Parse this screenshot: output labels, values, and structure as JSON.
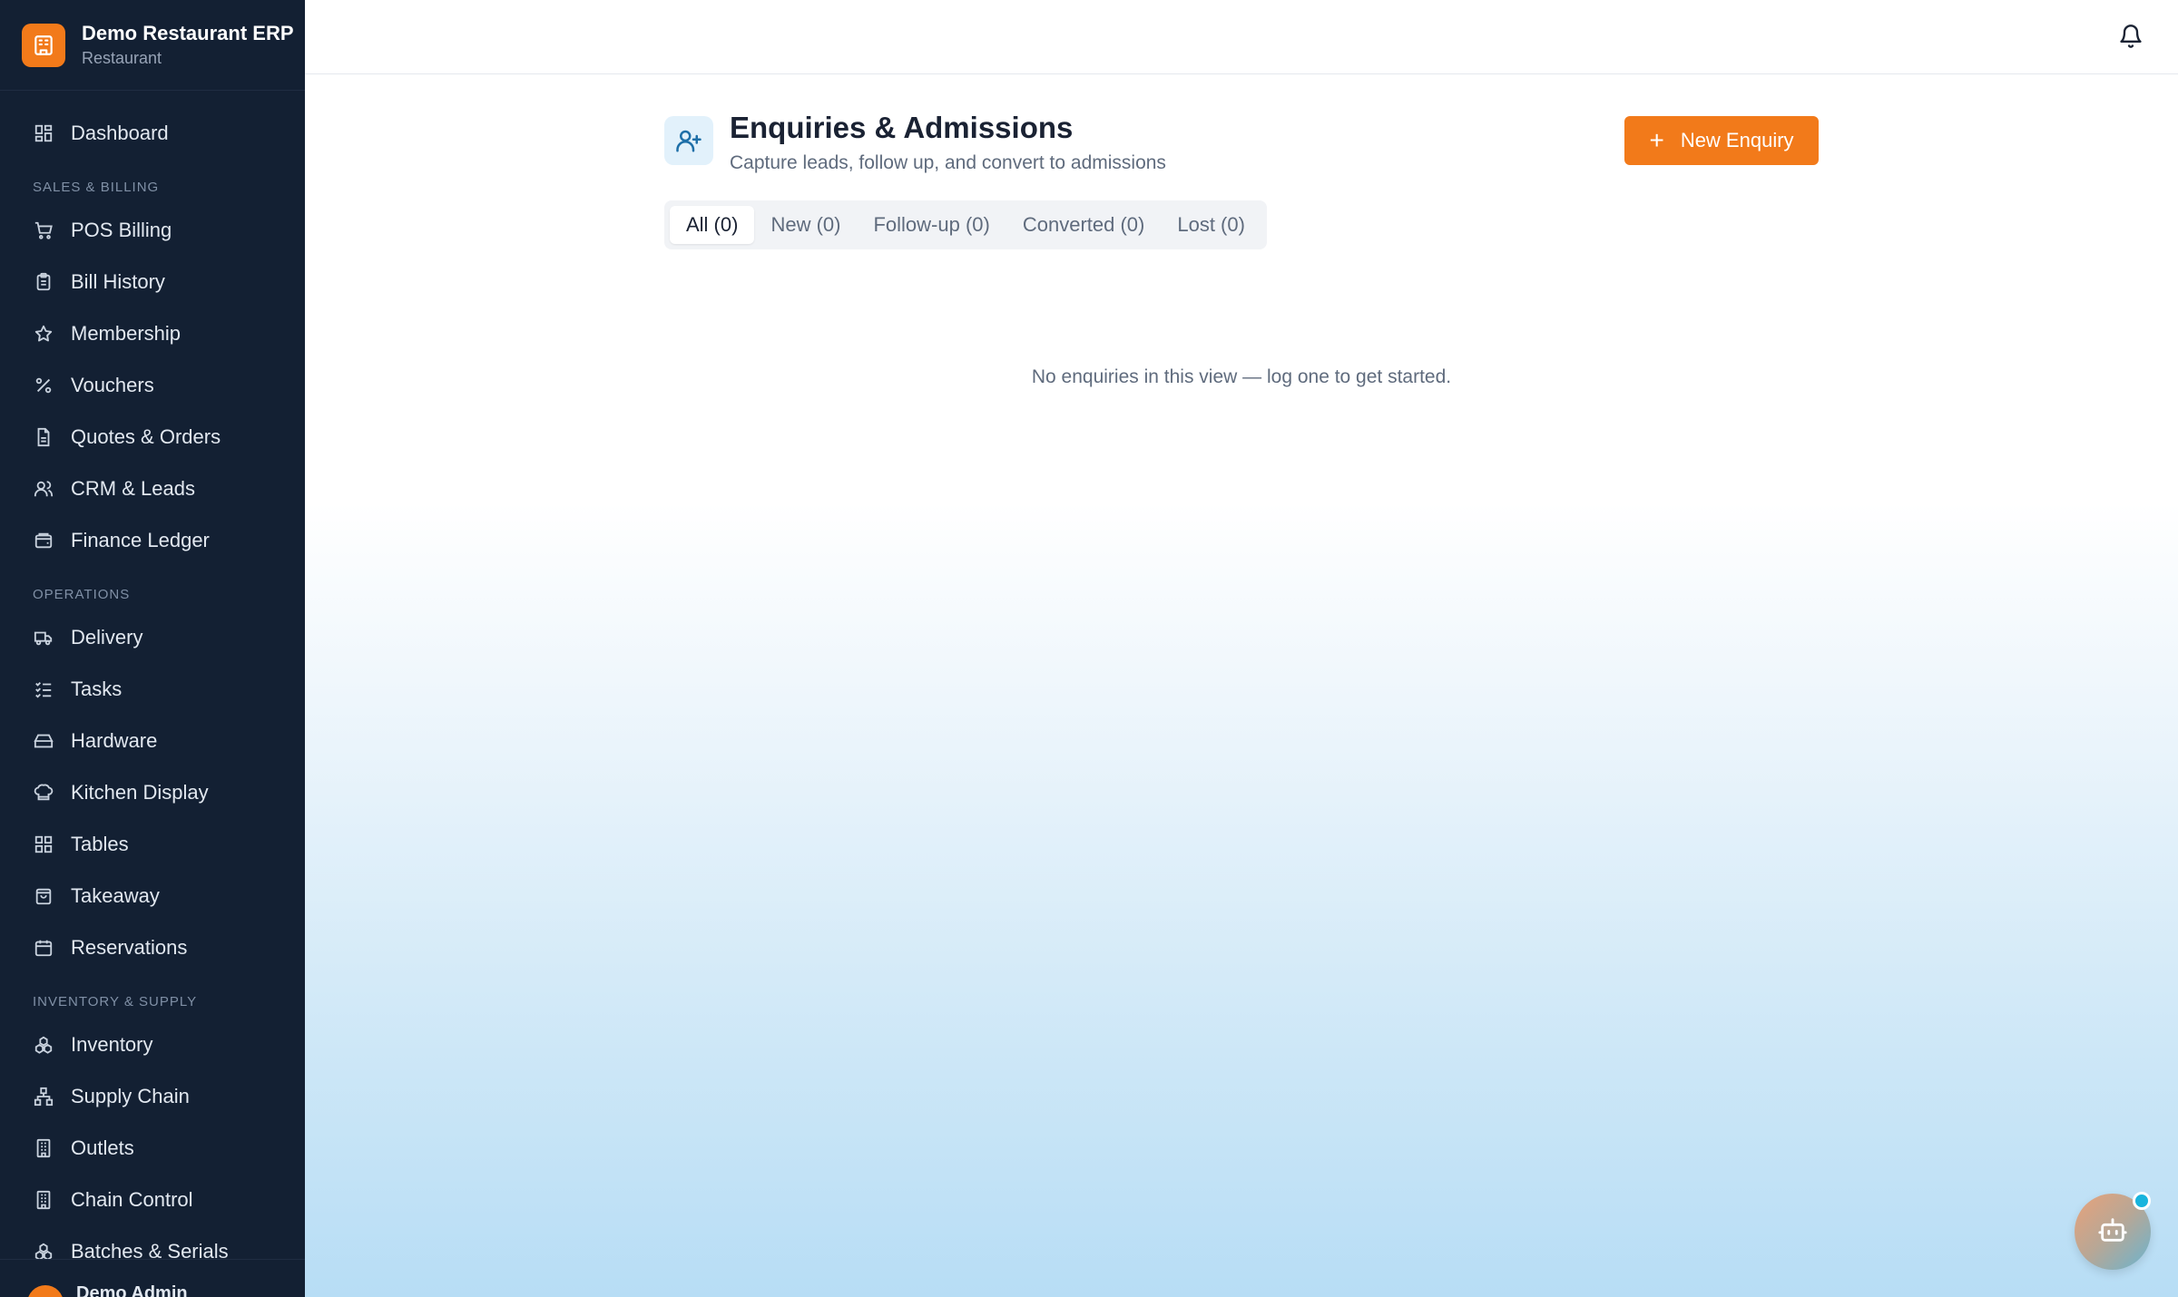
{
  "brand": {
    "title": "Demo Restaurant ERP",
    "subtitle": "Restaurant"
  },
  "sidebar": {
    "dashboard": {
      "label": "Dashboard",
      "icon": "dashboard-icon"
    },
    "sections": [
      {
        "label": "SALES & BILLING",
        "items": [
          {
            "label": "POS Billing",
            "icon": "cart-icon"
          },
          {
            "label": "Bill History",
            "icon": "clipboard-icon"
          },
          {
            "label": "Membership",
            "icon": "star-icon"
          },
          {
            "label": "Vouchers",
            "icon": "percent-icon"
          },
          {
            "label": "Quotes & Orders",
            "icon": "document-icon"
          },
          {
            "label": "CRM & Leads",
            "icon": "users-icon"
          },
          {
            "label": "Finance Ledger",
            "icon": "wallet-icon"
          }
        ]
      },
      {
        "label": "OPERATIONS",
        "items": [
          {
            "label": "Delivery",
            "icon": "truck-icon"
          },
          {
            "label": "Tasks",
            "icon": "checklist-icon"
          },
          {
            "label": "Hardware",
            "icon": "hard-drive-icon"
          },
          {
            "label": "Kitchen Display",
            "icon": "chef-hat-icon"
          },
          {
            "label": "Tables",
            "icon": "grid-icon"
          },
          {
            "label": "Takeaway",
            "icon": "shopping-bag-icon"
          },
          {
            "label": "Reservations",
            "icon": "calendar-icon"
          }
        ]
      },
      {
        "label": "INVENTORY & SUPPLY",
        "items": [
          {
            "label": "Inventory",
            "icon": "boxes-icon"
          },
          {
            "label": "Supply Chain",
            "icon": "network-icon"
          },
          {
            "label": "Outlets",
            "icon": "building-icon"
          },
          {
            "label": "Chain Control",
            "icon": "building-icon"
          },
          {
            "label": "Batches & Serials",
            "icon": "boxes-icon"
          }
        ]
      }
    ],
    "user": {
      "name": "Demo Admin"
    }
  },
  "header": {
    "title": "Enquiries & Admissions",
    "subtitle": "Capture leads, follow up, and convert to admissions",
    "new_button": "New Enquiry"
  },
  "tabs": [
    {
      "label": "All (0)",
      "active": true
    },
    {
      "label": "New (0)",
      "active": false
    },
    {
      "label": "Follow-up (0)",
      "active": false
    },
    {
      "label": "Converted (0)",
      "active": false
    },
    {
      "label": "Lost (0)",
      "active": false
    }
  ],
  "empty_message": "No enquiries in this view — log one to get started.",
  "colors": {
    "accent": "#f27a1a",
    "sidebar_bg": "#132033",
    "notification_dot": "#18b4dd"
  }
}
